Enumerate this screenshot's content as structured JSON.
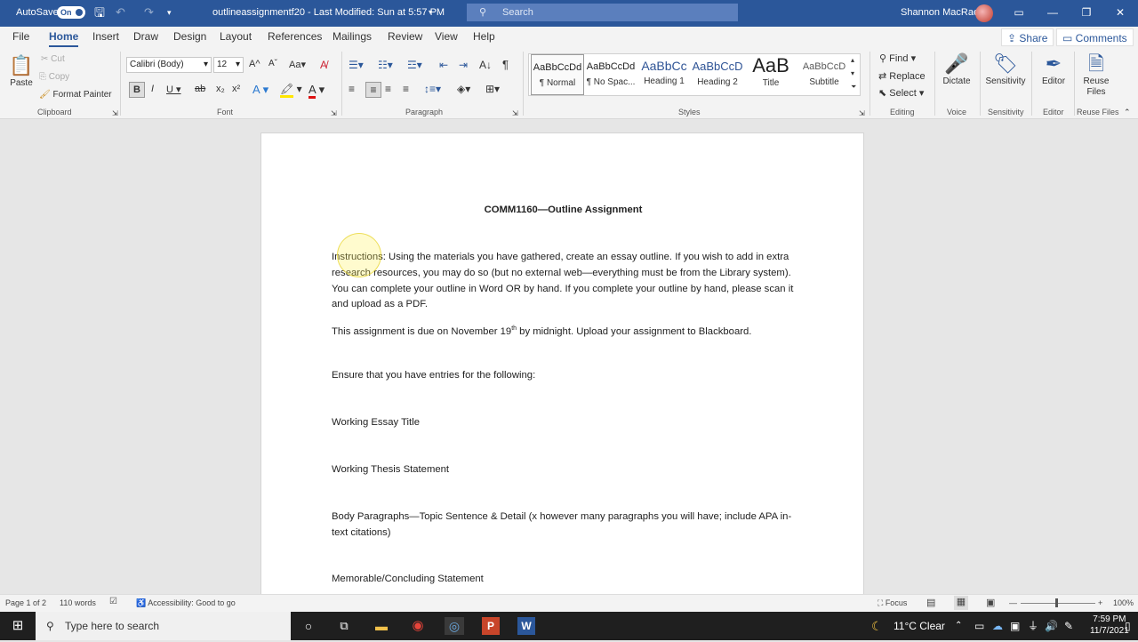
{
  "titlebar": {
    "autosave_label": "AutoSave",
    "autosave_state": "On",
    "doc_title": "outlineassignmentf20  -  Last Modified: Sun at 5:57 PM",
    "search_placeholder": "Search",
    "user_name": "Shannon MacRae"
  },
  "tabs": [
    "File",
    "Home",
    "Insert",
    "Draw",
    "Design",
    "Layout",
    "References",
    "Mailings",
    "Review",
    "View",
    "Help"
  ],
  "active_tab": "Home",
  "share_label": "Share",
  "comments_label": "Comments",
  "ribbon": {
    "clipboard": {
      "paste": "Paste",
      "cut": "Cut",
      "copy": "Copy",
      "format_painter": "Format Painter",
      "label": "Clipboard"
    },
    "font": {
      "name": "Calibri (Body)",
      "size": "12",
      "label": "Font"
    },
    "paragraph_label": "Paragraph",
    "styles": {
      "items": [
        {
          "preview": "AaBbCcDd",
          "name": "¶ Normal"
        },
        {
          "preview": "AaBbCcDd",
          "name": "¶ No Spac..."
        },
        {
          "preview": "AaBbCc",
          "name": "Heading 1"
        },
        {
          "preview": "AaBbCcD",
          "name": "Heading 2"
        },
        {
          "preview": "AaB",
          "name": "Title"
        },
        {
          "preview": "AaBbCcD",
          "name": "Subtitle"
        }
      ],
      "label": "Styles"
    },
    "editing": {
      "find": "Find",
      "replace": "Replace",
      "select": "Select",
      "label": "Editing"
    },
    "voice": {
      "dictate": "Dictate",
      "label": "Voice"
    },
    "sensitivity": {
      "button": "Sensitivity",
      "label": "Sensitivity"
    },
    "editor": {
      "button": "Editor",
      "label": "Editor"
    },
    "reuse": {
      "button": "Reuse Files",
      "label": "Reuse Files"
    }
  },
  "document": {
    "title": "COMM1160—Outline Assignment",
    "instructions": "Instructions:  Using the materials you have gathered, create an essay outline.  If you wish to add in extra research resources, you may do so (but no external web—everything must be from the Library system).  You can complete your outline in Word OR by hand.  If you complete your outline by hand, please scan it and upload as a PDF.",
    "due_pre": "This assignment is due on November 19",
    "due_sup": "th",
    "due_post": " by midnight.  Upload your assignment to Blackboard.",
    "ensure": "Ensure that you have entries for the following:",
    "item1": "Working Essay Title",
    "item2": "Working Thesis Statement",
    "item3": "Body Paragraphs—Topic Sentence & Detail (x however many paragraphs you will have; include APA in-text citations)",
    "item4": "Memorable/Concluding Statement"
  },
  "statusbar": {
    "page": "Page 1 of 2",
    "words": "110 words",
    "accessibility": "Accessibility: Good to go",
    "focus": "Focus",
    "zoom": "100%"
  },
  "taskbar": {
    "search_placeholder": "Type here to search",
    "weather": "11°C  Clear",
    "time": "7:59 PM",
    "date": "11/7/2021"
  },
  "colors": {
    "word_blue": "#2b579a",
    "taskbar": "#1f1f1f"
  }
}
